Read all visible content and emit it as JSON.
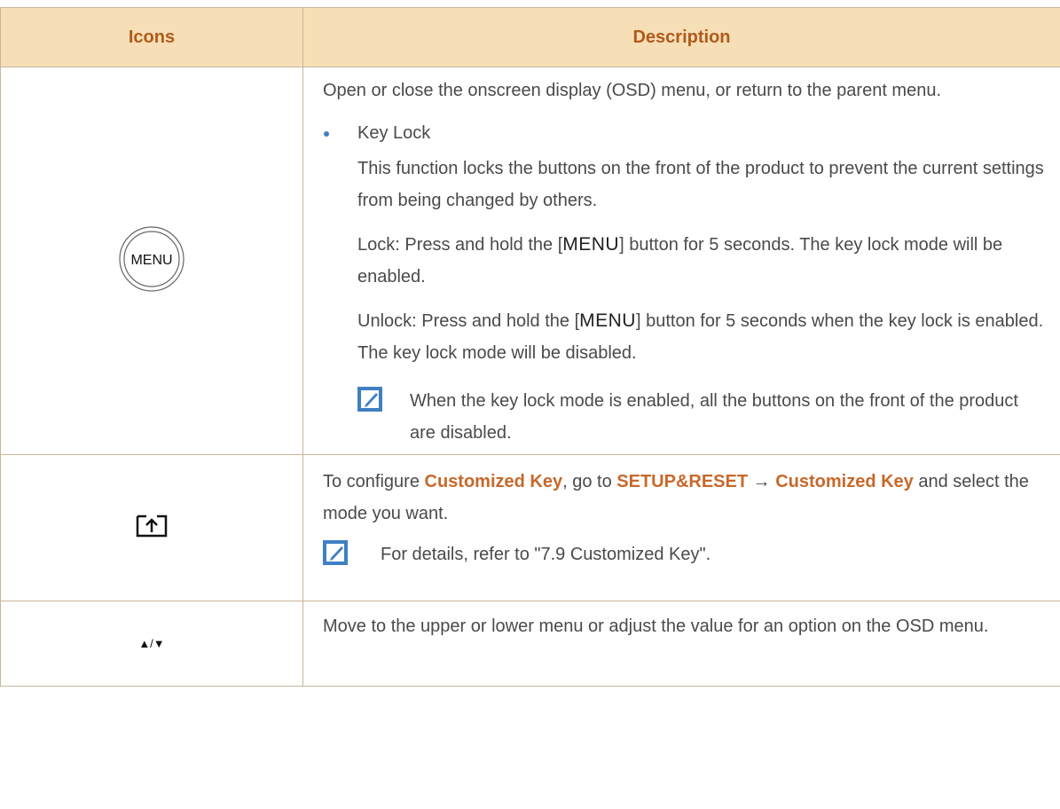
{
  "header": {
    "col_icons": "Icons",
    "col_description": "Description"
  },
  "row_menu": {
    "icon_text": "MENU",
    "intro": "Open or close the onscreen display (OSD) menu, or return to the parent menu.",
    "bullet_title": "Key Lock",
    "bullet_body": "This function locks the buttons on the front of the product to prevent the current settings from being changed by others.",
    "lock_prefix": "Lock: Press and hold the [",
    "lock_key": "MENU",
    "lock_suffix": "] button for 5 seconds. The key lock mode will be enabled.",
    "unlock_prefix": "Unlock: Press and hold the [",
    "unlock_key": "MENU",
    "unlock_suffix": "] button for 5 seconds when the key lock is enabled. The key lock mode will be disabled.",
    "note": "When the key lock mode is enabled, all the buttons on the front of the product are disabled."
  },
  "row_custom": {
    "t1": "To configure ",
    "h1": "Customized Key",
    "t2": ", go to ",
    "h2": "SETUP&RESET",
    "arrow": " → ",
    "h3": "Customized Key",
    "t3": " and select the mode you want.",
    "note": "For details, refer to \"7.9 Customized Key\"."
  },
  "row_updown": {
    "icon_text": "▲/▼",
    "text": "Move to the upper or lower menu or adjust the value for an option on the OSD menu."
  },
  "colors": {
    "header_bg": "#f6dfb6",
    "header_text": "#b05a1c",
    "highlight": "#c8682a",
    "border": "#c9b59a",
    "note_icon": "#3f7fc4"
  }
}
